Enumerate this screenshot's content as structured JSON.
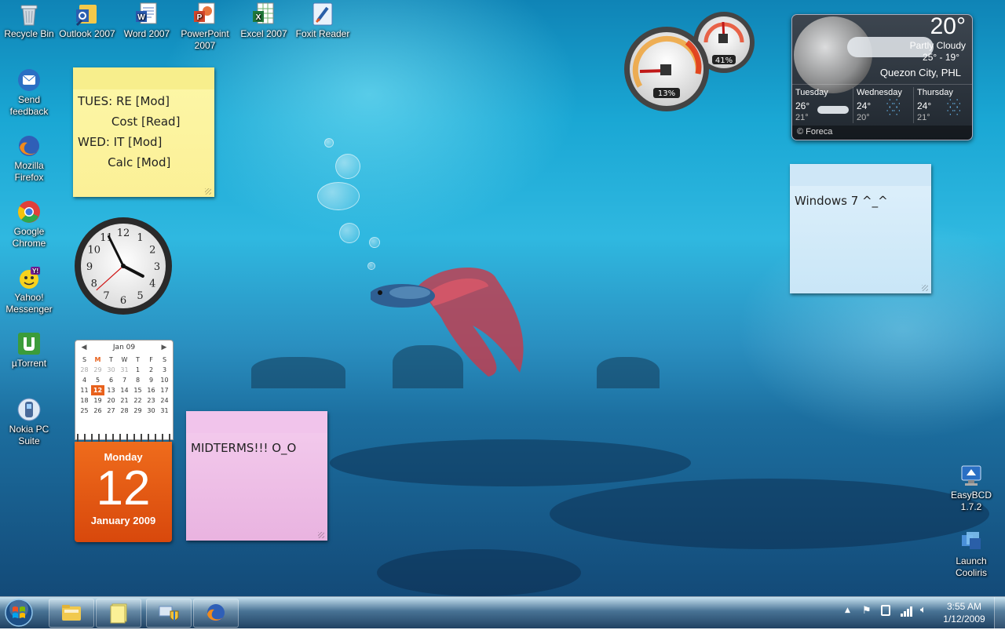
{
  "desktop_icons": [
    {
      "label": "Recycle Bin",
      "icon": "recycle-bin-icon"
    },
    {
      "label": "Outlook 2007",
      "icon": "outlook-icon"
    },
    {
      "label": "Word 2007",
      "icon": "word-icon"
    },
    {
      "label": "PowerPoint 2007",
      "icon": "powerpoint-icon"
    },
    {
      "label": "Excel 2007",
      "icon": "excel-icon"
    },
    {
      "label": "Foxit Reader",
      "icon": "foxit-reader-icon"
    },
    {
      "label": "Send feedback",
      "icon": "send-feedback-icon"
    },
    {
      "label": "Mozilla Firefox",
      "icon": "firefox-icon"
    },
    {
      "label": "Google Chrome",
      "icon": "chrome-icon"
    },
    {
      "label": "Yahoo! Messenger",
      "icon": "yahoo-messenger-icon"
    },
    {
      "label": "µTorrent",
      "icon": "utorrent-icon"
    },
    {
      "label": "Nokia PC Suite",
      "icon": "nokia-pc-suite-icon"
    },
    {
      "label": "EasyBCD 1.7.2",
      "icon": "easybcd-icon"
    },
    {
      "label": "Launch Cooliris",
      "icon": "cooliris-icon"
    }
  ],
  "sticky_notes": {
    "yellow": {
      "lines": [
        "TUES: RE [Mod]",
        "         Cost [Read]",
        "WED: IT [Mod]",
        "        Calc [Mod]"
      ],
      "color": "#fbf096"
    },
    "blue": {
      "lines": [
        "Windows 7 ^_^"
      ],
      "color": "#c9e6f7"
    },
    "pink": {
      "lines": [
        "MIDTERMS!!! O_O"
      ],
      "color": "#e9b3e0"
    }
  },
  "clock": {
    "hour": 3,
    "minute": 55,
    "second": 38
  },
  "calendar": {
    "month_label": "Jan 09",
    "weekdays": [
      "S",
      "M",
      "T",
      "W",
      "T",
      "F",
      "S"
    ],
    "today_index": 1,
    "weeks": [
      [
        "28",
        "29",
        "30",
        "31",
        "1",
        "2",
        "3"
      ],
      [
        "4",
        "5",
        "6",
        "7",
        "8",
        "9",
        "10"
      ],
      [
        "11",
        "12",
        "13",
        "14",
        "15",
        "16",
        "17"
      ],
      [
        "18",
        "19",
        "20",
        "21",
        "22",
        "23",
        "24"
      ],
      [
        "25",
        "26",
        "27",
        "28",
        "29",
        "30",
        "31"
      ]
    ],
    "today": "12",
    "day_name": "Monday",
    "day_number": "12",
    "month_year": "January 2009",
    "accent": "#e8611c"
  },
  "cpu_meter": {
    "cpu": "13%",
    "memory": "41%"
  },
  "weather": {
    "temp": "20°",
    "condition": "Partly Cloudy",
    "range": "25° - 19°",
    "location": "Quezon City, PHL",
    "forecast": [
      {
        "day": "Tuesday",
        "high": "26°",
        "low": "21°",
        "icon": "cloudy-icon"
      },
      {
        "day": "Wednesday",
        "high": "24°",
        "low": "20°",
        "icon": "rain-icon"
      },
      {
        "day": "Thursday",
        "high": "24°",
        "low": "21°",
        "icon": "rain-icon"
      }
    ],
    "credit": "© Foreca"
  },
  "taskbar": {
    "start_icon": "start-orb-icon",
    "pinned": [
      "windows-explorer-icon",
      "sticky-notes-icon",
      "network-shield-icon",
      "firefox-icon"
    ],
    "time": "3:55 AM",
    "date": "1/12/2009"
  }
}
